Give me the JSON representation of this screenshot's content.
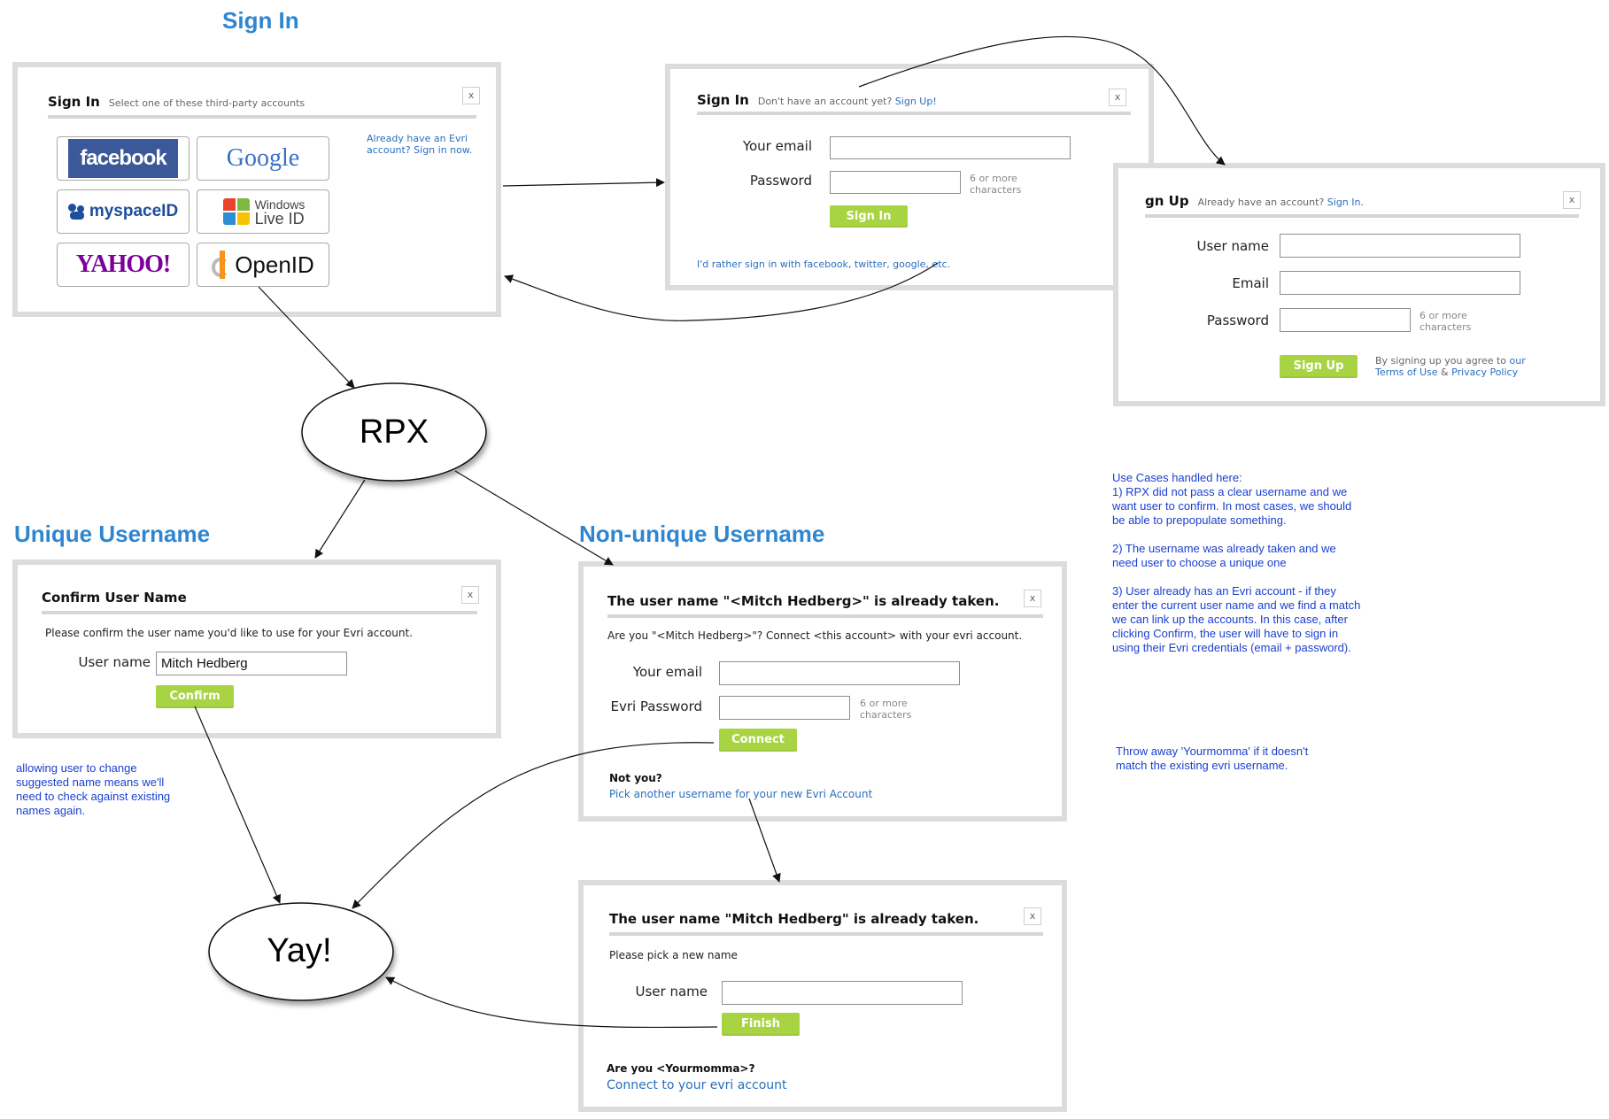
{
  "sections": {
    "sign_in": "Sign In",
    "unique_username": "Unique Username",
    "non_unique_username": "Non-unique Username"
  },
  "signin_providers_dialog": {
    "title": "Sign In",
    "subtitle": "Select one of these third-party accounts",
    "close": "x",
    "providers": [
      "facebook",
      "Google",
      "myspaceID",
      "Windows Live ID",
      "YAHOO!",
      "OpenID"
    ],
    "windows_live_line1": "Windows",
    "windows_live_line2": "Live ID",
    "already_link": "Already have an Evri account? Sign in now."
  },
  "signin_email_dialog": {
    "title": "Sign In",
    "subtitle_text": "Don't have an account yet?",
    "subtitle_link": "Sign Up!",
    "close": "x",
    "email_label": "Your email",
    "password_label": "Password",
    "password_hint": "6 or more characters",
    "button": "Sign In",
    "rather_link": "I'd rather sign in with facebook, twitter, google, etc."
  },
  "signup_dialog": {
    "title": "gn Up",
    "subtitle_text": "Already have an account?",
    "subtitle_link": "Sign In.",
    "close": "x",
    "username_label": "User name",
    "email_label": "Email",
    "password_label": "Password",
    "password_hint": "6 or more characters",
    "button": "Sign Up",
    "agree_text": "By signing up you agree to",
    "agree_our": "our",
    "terms_link": "Terms of Use",
    "amp": "&",
    "privacy_link": "Privacy Policy"
  },
  "rpx_node": "RPX",
  "yay_node": "Yay!",
  "confirm_dialog": {
    "title": "Confirm User Name",
    "close": "x",
    "prompt": "Please confirm the user name you'd like to use for your Evri account.",
    "username_label": "User name",
    "username_value": "Mitch Hedberg",
    "button": "Confirm"
  },
  "taken_dialog": {
    "title": "The user name \"<Mitch Hedberg>\" is already taken.",
    "close": "x",
    "prompt": "Are you \"<Mitch Hedberg>\"?  Connect <this account> with your evri account.",
    "email_label": "Your email",
    "password_label": "Evri Password",
    "password_hint": "6 or more characters",
    "button": "Connect",
    "not_you": "Not you?",
    "pick_link": "Pick another username for your new Evri Account"
  },
  "taken_dialog_2": {
    "title": "The user name \"Mitch Hedberg\" is already taken.",
    "close": "x",
    "prompt": "Please pick a new name",
    "username_label": "User name",
    "button": "Finish",
    "are_you": "Are you <Yourmomma>?",
    "connect_link": "Connect to your evri account"
  },
  "notes": {
    "allowing": "allowing user to change\nsuggested name means we'll\nneed to check against existing\nnames again.",
    "use_cases": "Use Cases handled here:\n1) RPX did not pass a clear username and we\nwant user to confirm.  In most cases, we should\nbe able to prepopulate something.\n\n2) The username was already taken and we\nneed user to choose a unique one\n\n3) User already has an Evri account - if they\nenter the current user name and we find a match\nwe can link up the accounts.   In this case, after\nclicking Confirm, the user will have to sign in\nusing their Evri credentials (email + password).",
    "throw_away": "Throw away 'Yourmomma' if it doesn't\n   match the existing evri username."
  },
  "colors": {
    "section_title": "#2f86d0",
    "button_green": "#a8d443",
    "link_blue": "#2a6fbf",
    "note_blue": "#1a3fcf",
    "facebook_blue": "#3b5998",
    "yahoo_purple": "#7b0099"
  }
}
